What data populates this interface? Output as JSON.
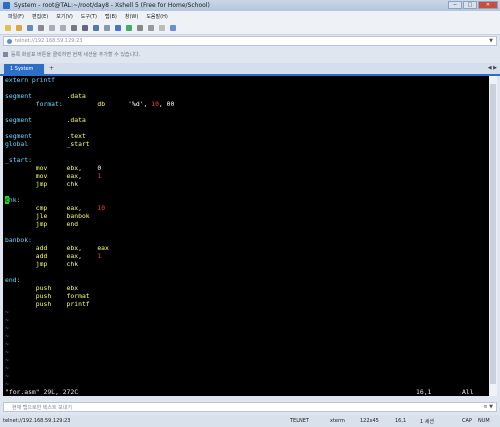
{
  "window": {
    "title": "System - root@TAL:~/root/day8 - Xshell 5 (Free for Home/School)",
    "buttons": {
      "minimize": "─",
      "maximize": "□",
      "close": "✕"
    }
  },
  "menu": [
    "파일(F)",
    "편집(E)",
    "보기(V)",
    "도구(T)",
    "탭(B)",
    "창(W)",
    "도움말(H)"
  ],
  "address": {
    "value": "telnet://192.168.59.129:23",
    "arrow": "▼"
  },
  "hint": "등록 화살표 버튼을 클릭하면 현재 세션을 추가할 수 있습니다.",
  "tabs": {
    "active": "1 System",
    "add": "+",
    "nav": "◀ ▶"
  },
  "terminal": {
    "lines": [
      {
        "row": 0,
        "parts": [
          {
            "t": "extern printf",
            "c": "lbl"
          }
        ]
      },
      {
        "row": 2,
        "parts": [
          {
            "t": "segment         ",
            "c": "lbl"
          },
          {
            "t": ".data",
            "c": "kw"
          }
        ]
      },
      {
        "row": 3,
        "parts": [
          {
            "t": "        format: ",
            "c": "lbl"
          },
          {
            "t": "        db      ",
            "c": "kw"
          },
          {
            "t": "'%d', ",
            "c": "txt"
          },
          {
            "t": "10",
            "c": "num"
          },
          {
            "t": ", 00",
            "c": "txt"
          }
        ]
      },
      {
        "row": 5,
        "parts": [
          {
            "t": "segment         ",
            "c": "lbl"
          },
          {
            "t": ".data",
            "c": "kw"
          }
        ]
      },
      {
        "row": 7,
        "parts": [
          {
            "t": "segment         ",
            "c": "lbl"
          },
          {
            "t": ".text",
            "c": "kw"
          }
        ]
      },
      {
        "row": 8,
        "parts": [
          {
            "t": "global          ",
            "c": "lbl"
          },
          {
            "t": "_start",
            "c": "kw"
          }
        ]
      },
      {
        "row": 10,
        "parts": [
          {
            "t": "_start:",
            "c": "lbl"
          }
        ]
      },
      {
        "row": 11,
        "parts": [
          {
            "t": "        mov     ebx,    ",
            "c": "kw"
          },
          {
            "t": "0",
            "c": "txt"
          }
        ]
      },
      {
        "row": 12,
        "parts": [
          {
            "t": "        mov     eax,    ",
            "c": "kw"
          },
          {
            "t": "1",
            "c": "num"
          }
        ]
      },
      {
        "row": 13,
        "parts": [
          {
            "t": "        jmp     chk",
            "c": "kw"
          }
        ]
      },
      {
        "row": 15,
        "parts": [
          {
            "t": "c",
            "c": "cur"
          },
          {
            "t": "hk:",
            "c": "lbl"
          }
        ]
      },
      {
        "row": 16,
        "parts": [
          {
            "t": "        cmp     eax,    ",
            "c": "kw"
          },
          {
            "t": "10",
            "c": "num"
          }
        ]
      },
      {
        "row": 17,
        "parts": [
          {
            "t": "        jle     banbok",
            "c": "kw"
          }
        ]
      },
      {
        "row": 18,
        "parts": [
          {
            "t": "        jmp     end",
            "c": "kw"
          }
        ]
      },
      {
        "row": 20,
        "parts": [
          {
            "t": "banbok:",
            "c": "lbl"
          }
        ]
      },
      {
        "row": 21,
        "parts": [
          {
            "t": "        add     ebx,    eax",
            "c": "kw"
          }
        ]
      },
      {
        "row": 22,
        "parts": [
          {
            "t": "        add     eax,    ",
            "c": "kw"
          },
          {
            "t": "1",
            "c": "num"
          }
        ]
      },
      {
        "row": 23,
        "parts": [
          {
            "t": "        jmp     chk",
            "c": "kw"
          }
        ]
      },
      {
        "row": 25,
        "parts": [
          {
            "t": "end:",
            "c": "lbl"
          }
        ]
      },
      {
        "row": 26,
        "parts": [
          {
            "t": "        push    ebx",
            "c": "kw"
          }
        ]
      },
      {
        "row": 27,
        "parts": [
          {
            "t": "        push    format",
            "c": "kw"
          }
        ]
      },
      {
        "row": 28,
        "parts": [
          {
            "t": "        push    printf",
            "c": "kw"
          }
        ]
      }
    ],
    "tilde": "~",
    "tilde_rows": [
      29,
      30,
      31,
      32,
      33,
      34,
      35,
      36,
      37,
      38
    ],
    "status_file": "\"for.asm\" 29L, 272C",
    "status_pos": "16,1",
    "status_all": "All"
  },
  "sendbar": {
    "placeholder": "현재 탭으로만 텍스트 보내기",
    "menu": "≡ ▼"
  },
  "statusbar": {
    "conn": "telnet://192.168.59.129:23",
    "proto": "TELNET",
    "term": "xterm",
    "size": "122x45",
    "cursor": "16,1",
    "sessions": "1 세션",
    "cap": "CAP",
    "num": "NUM"
  }
}
